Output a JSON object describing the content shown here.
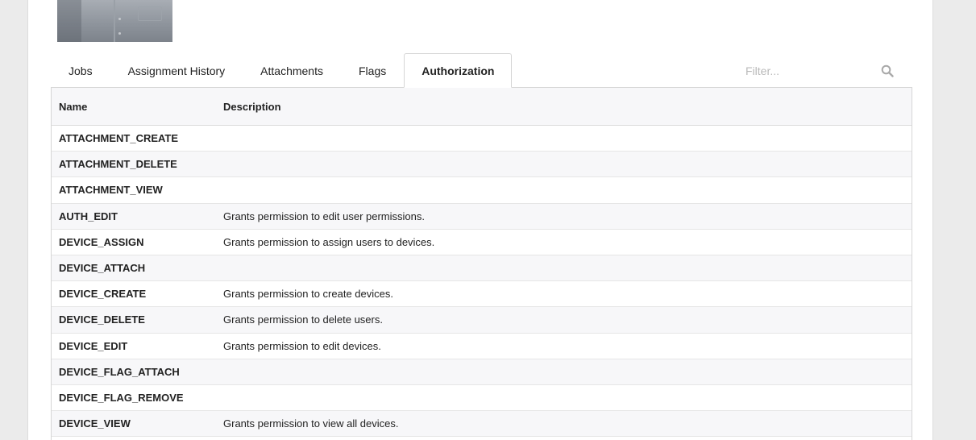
{
  "tabs": [
    {
      "label": "Jobs",
      "active": false
    },
    {
      "label": "Assignment History",
      "active": false
    },
    {
      "label": "Attachments",
      "active": false
    },
    {
      "label": "Flags",
      "active": false
    },
    {
      "label": "Authorization",
      "active": true
    }
  ],
  "filter": {
    "placeholder": "Filter...",
    "icon": "search-icon"
  },
  "table": {
    "columns": [
      "Name",
      "Description"
    ],
    "rows": [
      {
        "name": "ATTACHMENT_CREATE",
        "description": ""
      },
      {
        "name": "ATTACHMENT_DELETE",
        "description": ""
      },
      {
        "name": "ATTACHMENT_VIEW",
        "description": ""
      },
      {
        "name": "AUTH_EDIT",
        "description": "Grants permission to edit user permissions."
      },
      {
        "name": "DEVICE_ASSIGN",
        "description": "Grants permission to assign users to devices."
      },
      {
        "name": "DEVICE_ATTACH",
        "description": ""
      },
      {
        "name": "DEVICE_CREATE",
        "description": "Grants permission to create devices."
      },
      {
        "name": "DEVICE_DELETE",
        "description": "Grants permission to delete users."
      },
      {
        "name": "DEVICE_EDIT",
        "description": "Grants permission to edit devices."
      },
      {
        "name": "DEVICE_FLAG_ATTACH",
        "description": ""
      },
      {
        "name": "DEVICE_FLAG_REMOVE",
        "description": ""
      },
      {
        "name": "DEVICE_VIEW",
        "description": "Grants permission to view all devices."
      }
    ]
  }
}
